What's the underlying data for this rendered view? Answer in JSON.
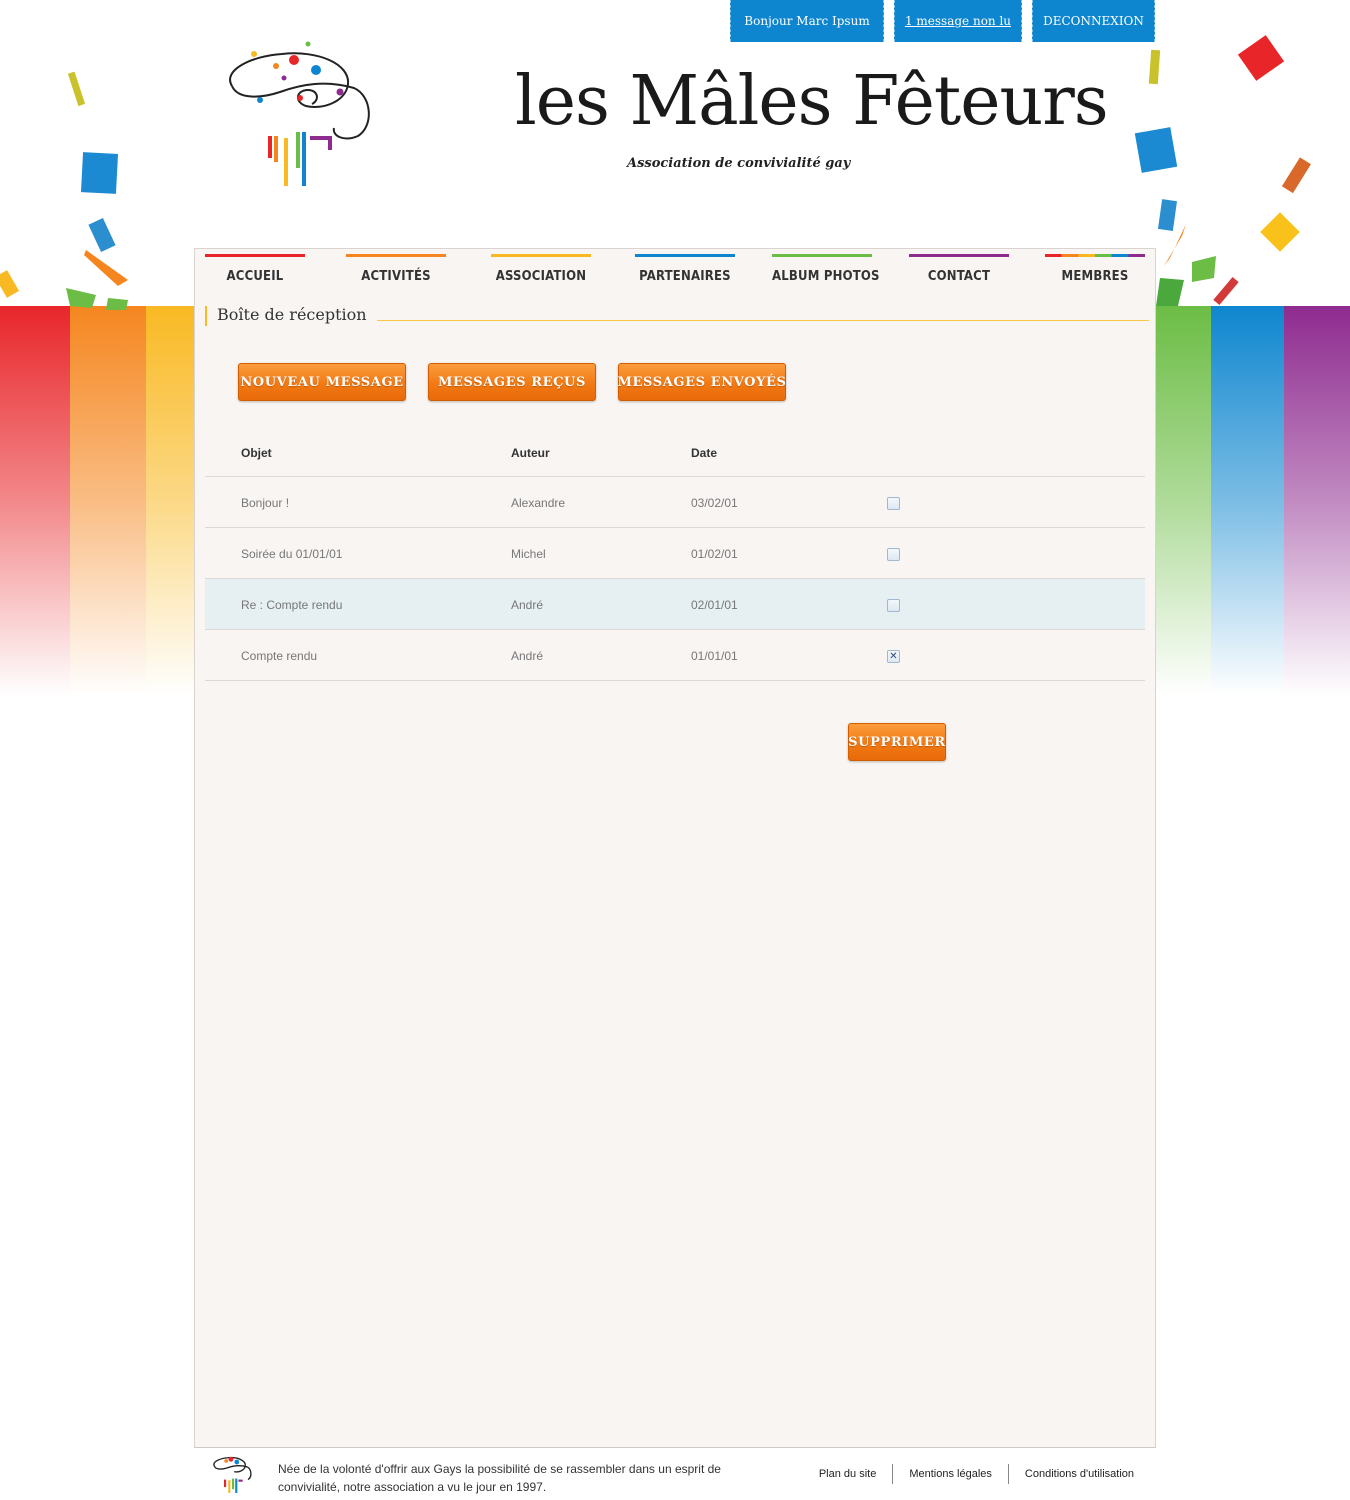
{
  "userbar": {
    "greeting": "Bonjour Marc Ipsum",
    "unread": "1 message non lu",
    "logout": "DECONNEXION"
  },
  "brand": {
    "name": "les Mâles Fêteurs",
    "tagline": "Association de convivialité gay"
  },
  "nav": [
    {
      "label": "ACCUEIL",
      "color": "#e8262a"
    },
    {
      "label": "ACTIVITÉS",
      "color": "#f5861f"
    },
    {
      "label": "ASSOCIATION",
      "color": "#f9b923"
    },
    {
      "label": "PARTENAIRES",
      "color": "#0e86cf"
    },
    {
      "label": "ALBUM PHOTOS",
      "color": "#6cbd45"
    },
    {
      "label": "CONTACT",
      "color": "#8e2b8f"
    },
    {
      "label": "MEMBRES",
      "color": "rainbow"
    }
  ],
  "section": {
    "title": "Boîte de réception"
  },
  "actions": {
    "new_message": "NOUVEAU MESSAGE",
    "received": "MESSAGES REÇUS",
    "sent": "MESSAGES ENVOYÉS",
    "delete": "SUPPRIMER"
  },
  "table": {
    "headers": {
      "subject": "Objet",
      "author": "Auteur",
      "date": "Date"
    },
    "rows": [
      {
        "subject": "Bonjour !",
        "author": "Alexandre",
        "date": "03/02/01",
        "checked": false,
        "highlighted": false
      },
      {
        "subject": "Soirée du 01/01/01",
        "author": "Michel",
        "date": "01/02/01",
        "checked": false,
        "highlighted": false
      },
      {
        "subject": "Re : Compte rendu",
        "author": "André",
        "date": "02/01/01",
        "checked": false,
        "highlighted": true
      },
      {
        "subject": "Compte rendu",
        "author": "André",
        "date": "01/01/01",
        "checked": true,
        "highlighted": false
      }
    ]
  },
  "footer": {
    "text": "Née de la volonté d'offrir aux Gays la possibilité de se rassembler dans un esprit de convivialité, notre association a vu le jour en 1997.",
    "links": [
      "Plan du site",
      "Mentions légales",
      "Conditions d'utilisation"
    ]
  },
  "colors": {
    "accent_blue": "#0e86cf",
    "button_orange": "#f27a14",
    "rainbow": [
      "#e8262a",
      "#f5861f",
      "#f9b923",
      "#6cbd45",
      "#0e86cf",
      "#8e2b8f"
    ]
  }
}
